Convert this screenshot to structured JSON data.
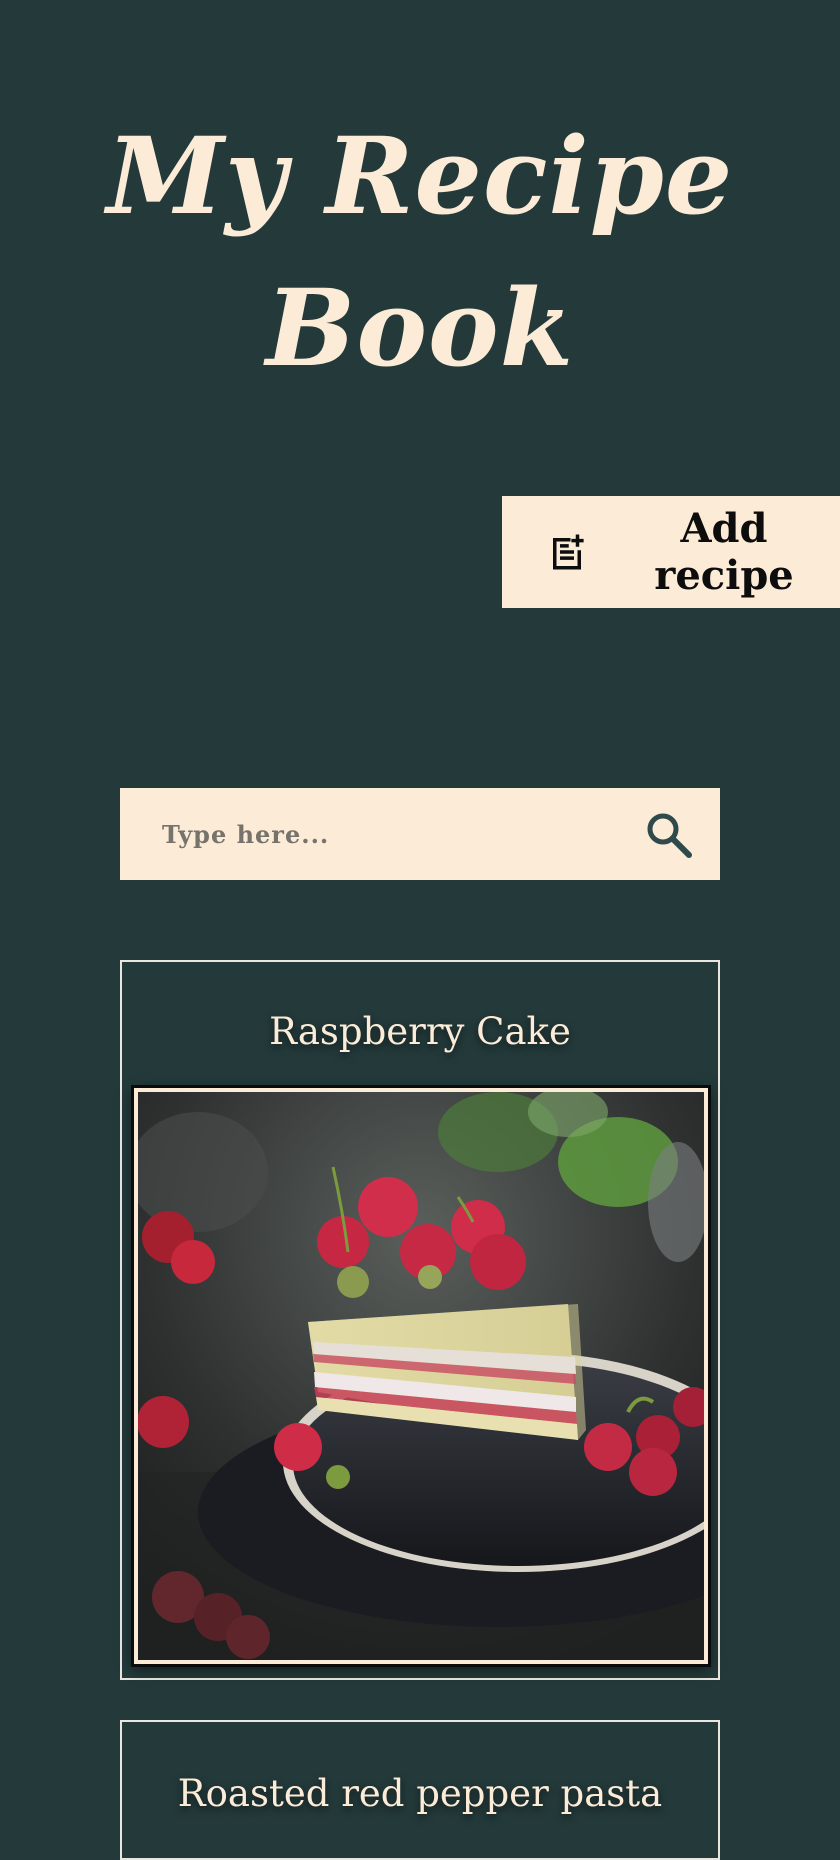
{
  "header": {
    "title": "My Recipe Book"
  },
  "actions": {
    "add_recipe_label": "Add recipe",
    "add_recipe_icon": "note-add-icon"
  },
  "search": {
    "placeholder": "Type here...",
    "icon": "search-icon"
  },
  "recipes": [
    {
      "title": "Raspberry Cake",
      "image": "raspberry-cake-photo"
    },
    {
      "title": "Roasted red pepper pasta"
    }
  ],
  "colors": {
    "background": "#23393a",
    "cream": "#fbebd7",
    "text_dark": "#0d0d0d"
  }
}
